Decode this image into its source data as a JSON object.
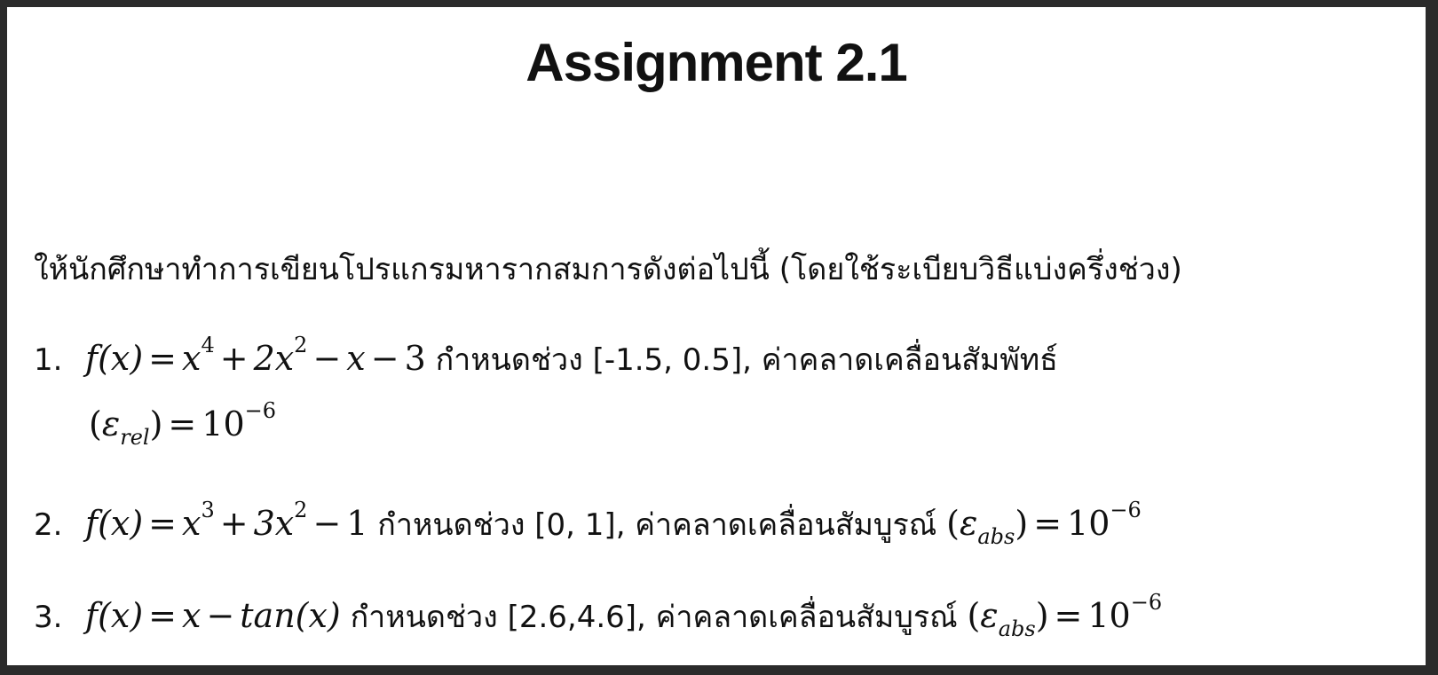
{
  "title": "Assignment 2.1",
  "instruction": "ให้นักศึกษาทำการเขียนโปรแกรมหารากสมการดังต่อไปนี้ (โดยใช้ระเบียบวิธีแบ่งครึ่งช่วง)",
  "items": [
    {
      "number": "1.",
      "fx": "f(x)",
      "eq": "=",
      "t1_base": "x",
      "t1_exp": "4",
      "plus1": "+",
      "t2_coef": "2x",
      "t2_exp": "2",
      "minus1": "−",
      "t3": "x",
      "minus2": "−",
      "t4": "3",
      "interval_text": " กำหนดช่วง [-1.5, 0.5], ค่าคลาดเคลื่อนสัมพัทธ์",
      "eps_open": "(",
      "eps": "ε",
      "eps_sub": "rel",
      "eps_close": ")",
      "eq2": "=",
      "tol_base": "10",
      "tol_exp": "−6"
    },
    {
      "number": "2.",
      "fx": "f(x)",
      "eq": "=",
      "t1_base": "x",
      "t1_exp": "3",
      "plus1": "+",
      "t2_coef": "3x",
      "t2_exp": "2",
      "minus1": "−",
      "t3": "1",
      "interval_text": " กำหนดช่วง [0, 1], ค่าคลาดเคลื่อนสัมบูรณ์ ",
      "eps_open": "(",
      "eps": "ε",
      "eps_sub": "abs",
      "eps_close": ")",
      "eq2": "=",
      "tol_base": "10",
      "tol_exp": "−6"
    },
    {
      "number": "3.",
      "fx": "f(x)",
      "eq": "=",
      "t1": "x",
      "minus1": "−",
      "t2": "tan(x)",
      "interval_text": " กำหนดช่วง [2.6,4.6], ค่าคลาดเคลื่อนสัมบูรณ์ ",
      "eps_open": "(",
      "eps": "ε",
      "eps_sub": "abs",
      "eps_close": ")",
      "eq2": "=",
      "tol_base": "10",
      "tol_exp": "−6"
    }
  ]
}
